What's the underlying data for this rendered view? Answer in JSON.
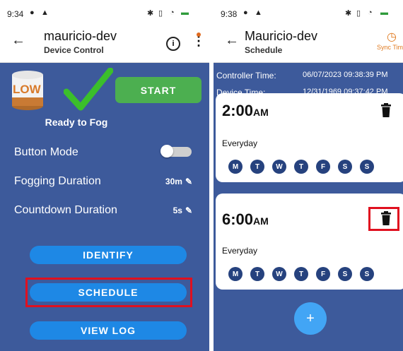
{
  "left": {
    "status_time": "9:34",
    "app_title": "mauricio-dev",
    "app_subtitle": "Device Control",
    "level_label": "LOW",
    "start_label": "START",
    "ready_text": "Ready to Fog",
    "rows": [
      {
        "label": "Button Mode",
        "value": ""
      },
      {
        "label": "Fogging Duration",
        "value": "30m"
      },
      {
        "label": "Countdown Duration",
        "value": "5s"
      }
    ],
    "buttons": [
      "IDENTIFY",
      "SCHEDULE",
      "VIEW LOG"
    ]
  },
  "right": {
    "status_time": "9:38",
    "app_title": "Mauricio-dev",
    "app_subtitle": "Schedule",
    "sync_label": "Sync Time",
    "controller_time_label": "Controller Time:",
    "controller_time_value": "06/07/2023 09:38:39 PM",
    "device_time_label": "Device Time:",
    "device_time_value": "12/31/1969 09:37:42 PM",
    "schedules": [
      {
        "time": "2:00",
        "ampm": "AM",
        "repeat": "Everyday"
      },
      {
        "time": "6:00",
        "ampm": "AM",
        "repeat": "Everyday"
      }
    ],
    "days": [
      "M",
      "T",
      "W",
      "T",
      "F",
      "S",
      "S"
    ],
    "fab_label": "+"
  },
  "colors": {
    "background": "#3d5a9b",
    "accent_green": "#4caf50",
    "button_blue": "#1e88e5",
    "highlight_red": "#e0101f",
    "sync_orange": "#e07a1f"
  }
}
